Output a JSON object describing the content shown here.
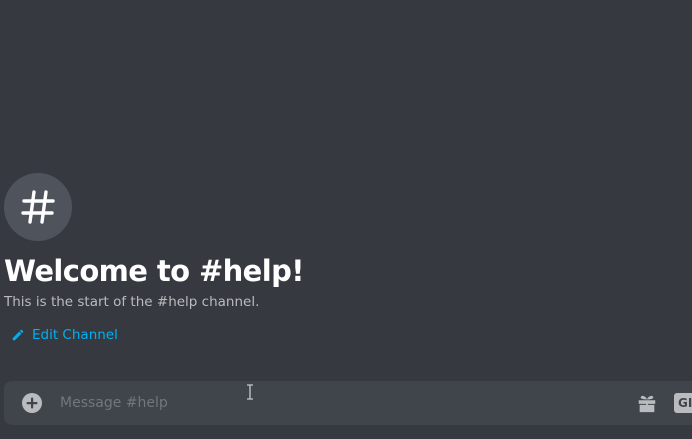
{
  "channel": {
    "name": "help",
    "icon": "hash-icon"
  },
  "welcome": {
    "title": "Welcome to #help!",
    "subtitle": "This is the start of the #help channel.",
    "edit_label": "Edit Channel",
    "edit_icon": "pencil-icon"
  },
  "composer": {
    "placeholder": "Message #help",
    "value": "",
    "add_icon": "plus-circle-icon",
    "gift_icon": "gift-icon",
    "gif_label": "GIF"
  },
  "colors": {
    "background": "#36393f",
    "composer": "#40444b",
    "link": "#00b0f4",
    "title": "#ffffff",
    "subtitle": "#b9bbbe"
  }
}
